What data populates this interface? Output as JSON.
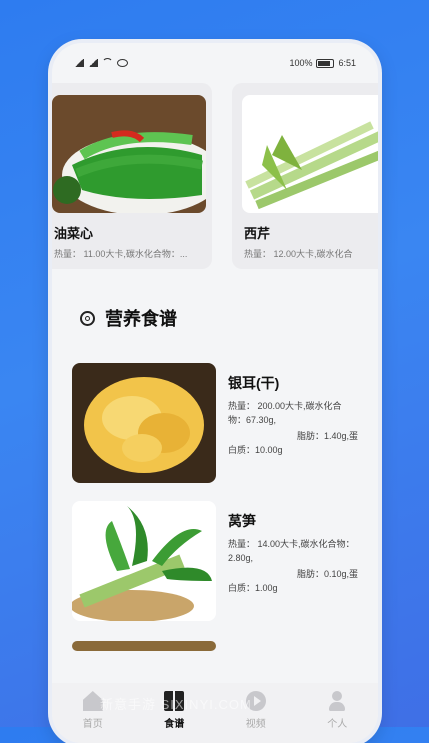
{
  "status": {
    "battery": "100%",
    "time": "6:51"
  },
  "carousel": [
    {
      "name": "油菜心",
      "info": "热量： 11.00大卡,碳水化合物：..."
    },
    {
      "name": "西芹",
      "info": "热量： 12.00大卡,碳水化合"
    }
  ],
  "section": {
    "title": "营养食谱"
  },
  "recipes": [
    {
      "name": "银耳(干)",
      "line1": "热量： 200.00大卡,碳水化合物：67.30g,",
      "line2": "脂肪：1.40g,蛋",
      "line3": "白质：10.00g"
    },
    {
      "name": "莴笋",
      "line1": "热量： 14.00大卡,碳水化合物：2.80g,",
      "line2": "脂肪：0.10g,蛋",
      "line3": "白质：1.00g"
    }
  ],
  "tabs": [
    {
      "label": "首页",
      "icon": "home-icon"
    },
    {
      "label": "食谱",
      "icon": "book-icon"
    },
    {
      "label": "视频",
      "icon": "play-icon"
    },
    {
      "label": "个人",
      "icon": "user-icon"
    }
  ],
  "watermark": "新意手游 SIXINYI.COM"
}
